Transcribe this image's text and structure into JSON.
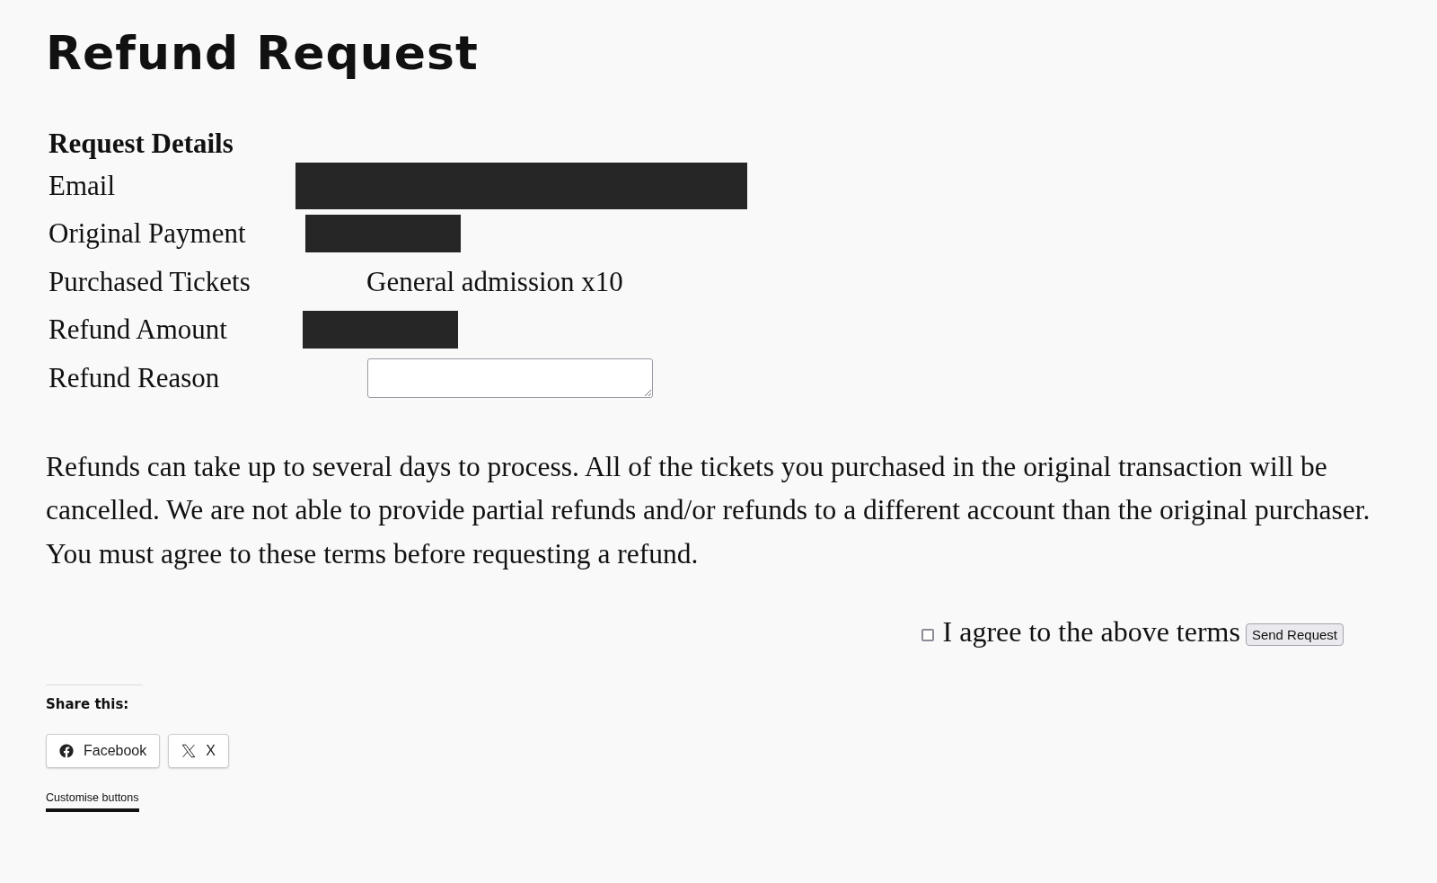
{
  "title": "Refund Request",
  "details": {
    "heading": "Request Details",
    "rows": [
      {
        "label": "Email",
        "kind": "redacted"
      },
      {
        "label": "Original Payment",
        "kind": "redacted"
      },
      {
        "label": "Purchased Tickets",
        "kind": "text",
        "value": "General admission x10"
      },
      {
        "label": "Refund Amount",
        "kind": "redacted"
      },
      {
        "label": "Refund Reason",
        "kind": "textarea"
      }
    ]
  },
  "terms": "Refunds can take up to several days to process. All of the tickets you purchased in the original transaction will be cancelled. We are not able to provide partial refunds and/or refunds to a different account than the original purchaser. You must agree to these terms before requesting a refund.",
  "agree": {
    "label": "I agree to the above terms",
    "checked": false
  },
  "submit": "Send Request",
  "share": {
    "heading": "Share this:",
    "buttons": [
      {
        "label": "Facebook",
        "kind": "facebook"
      },
      {
        "label": "X",
        "kind": "x"
      }
    ],
    "customise": "Customise buttons"
  }
}
